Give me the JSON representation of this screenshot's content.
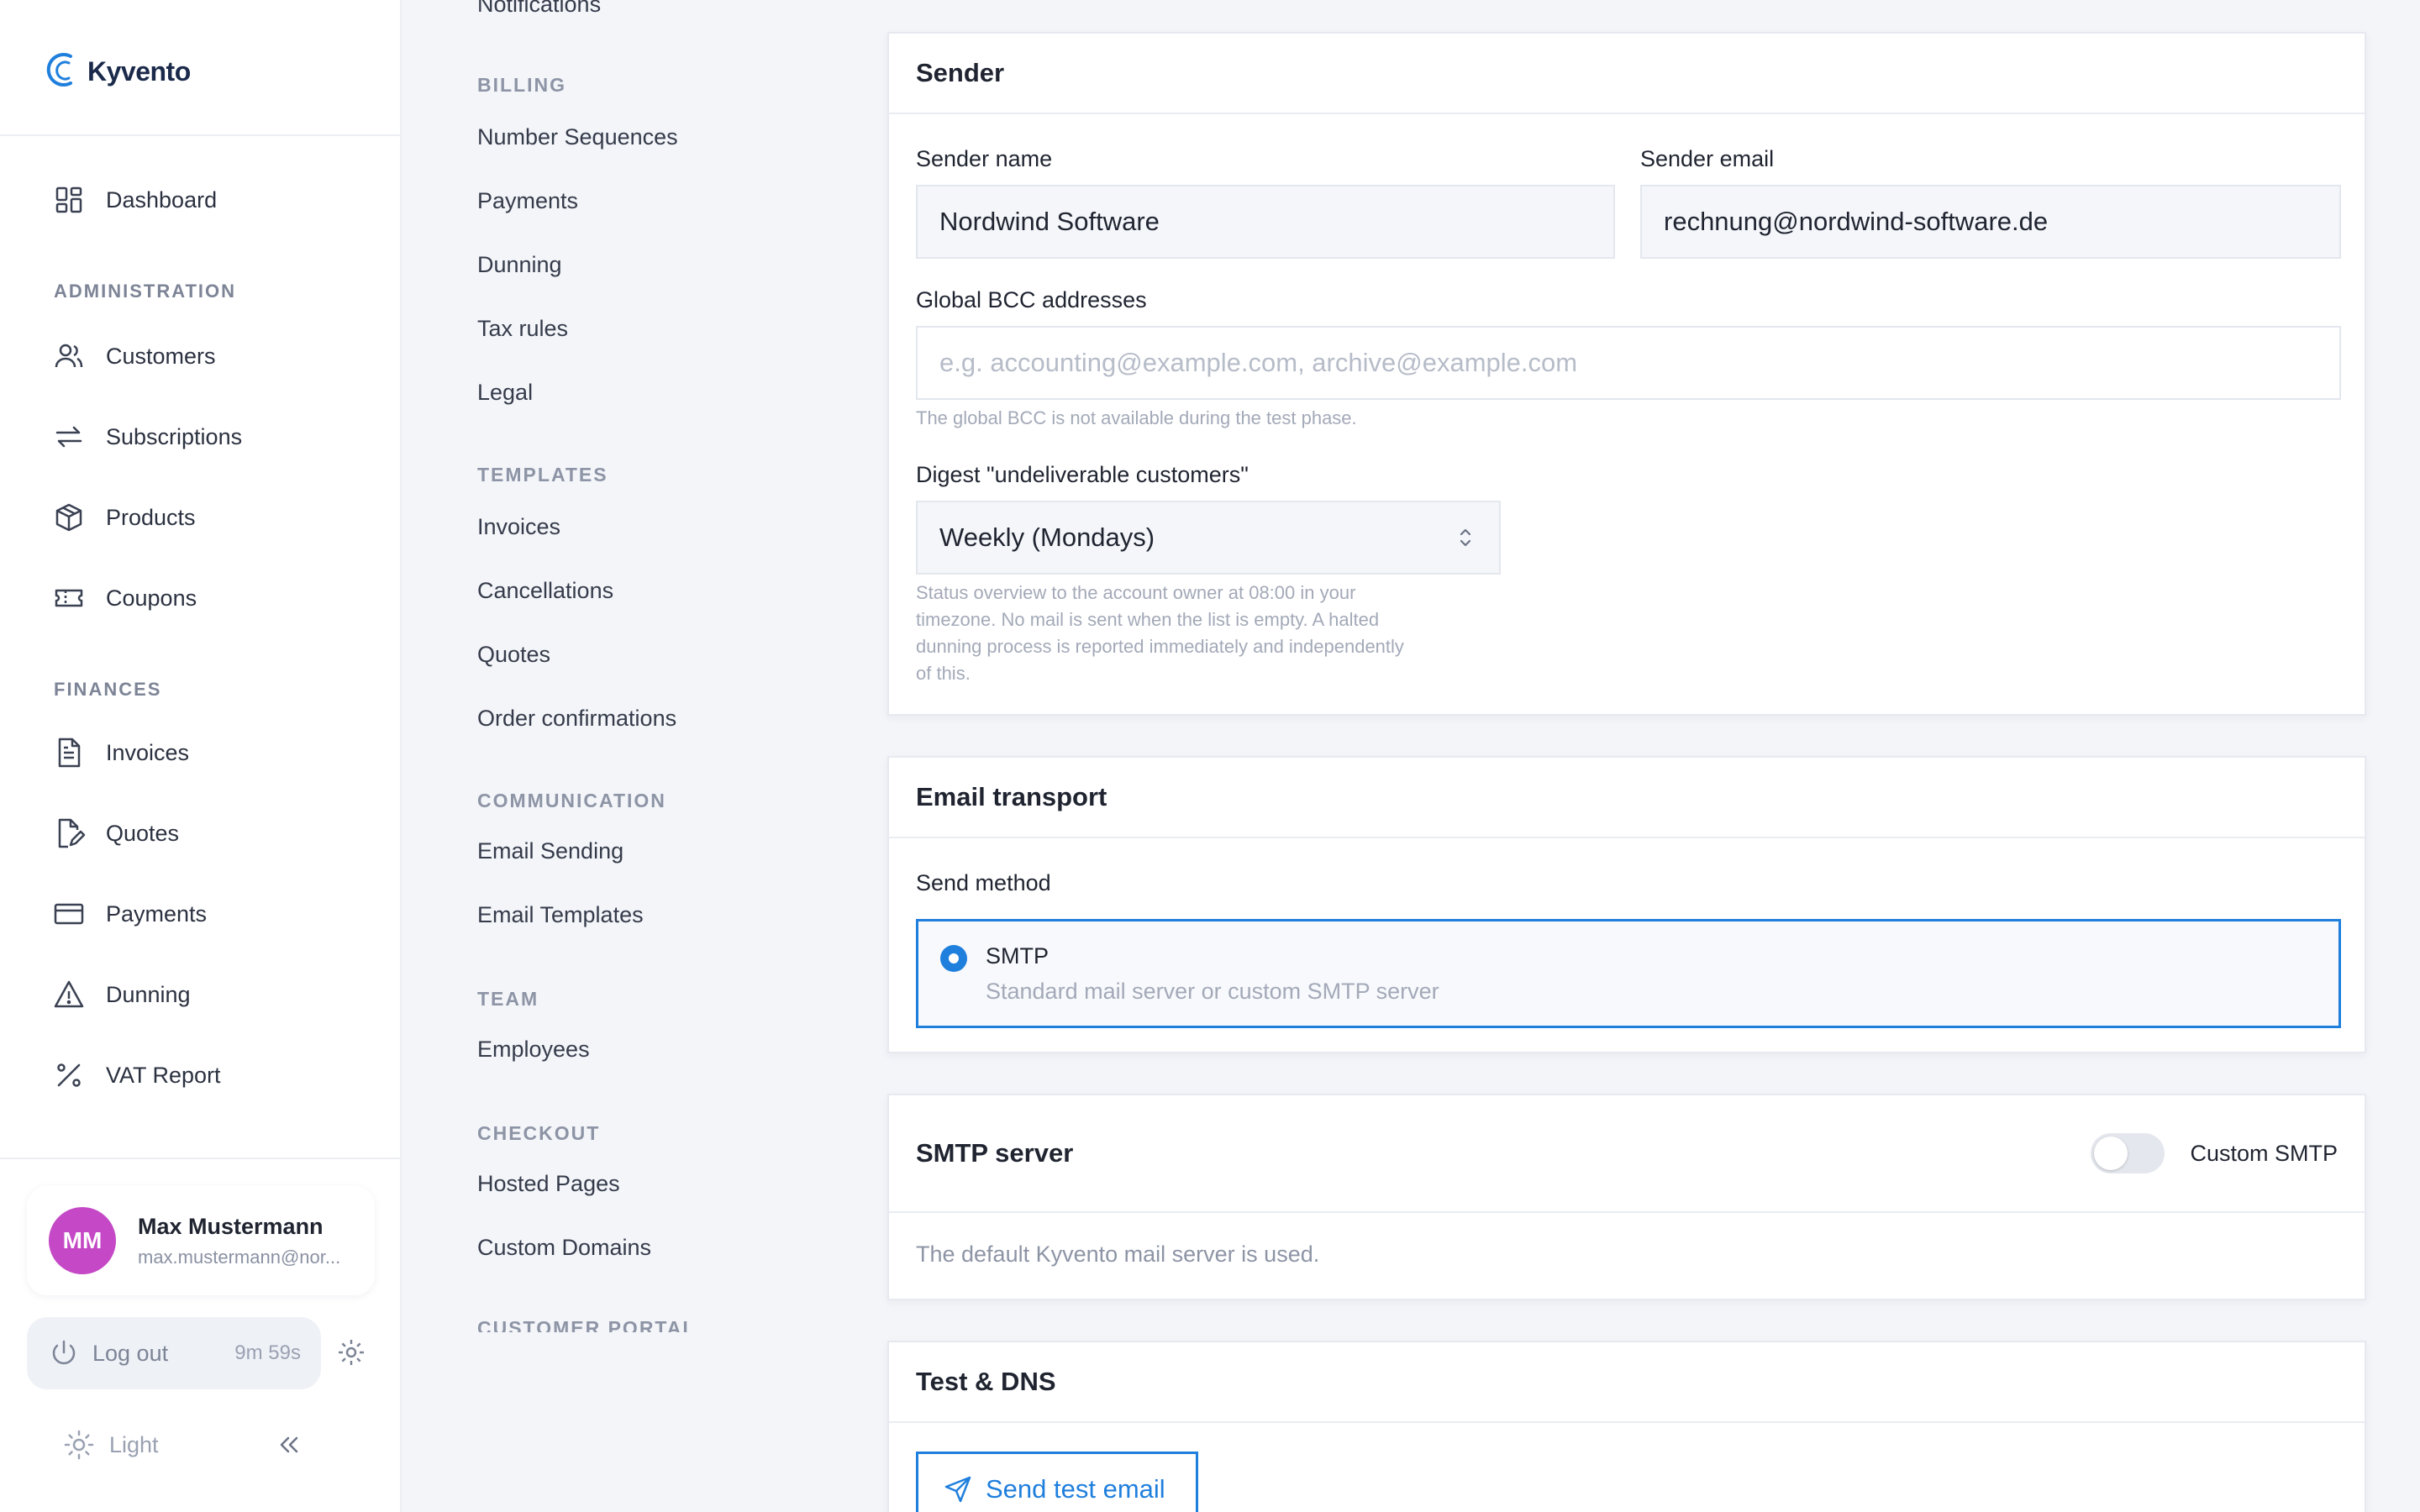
{
  "brand": {
    "name": "Kyvento"
  },
  "sidebar": {
    "dashboard": "Dashboard",
    "administration_heading": "ADMINISTRATION",
    "customers": "Customers",
    "subscriptions": "Subscriptions",
    "products": "Products",
    "coupons": "Coupons",
    "finances_heading": "FINANCES",
    "invoices": "Invoices",
    "quotes": "Quotes",
    "payments": "Payments",
    "dunning": "Dunning",
    "vat_report": "VAT Report"
  },
  "user": {
    "initials": "MM",
    "name": "Max Mustermann",
    "email": "max.mustermann@nor...",
    "logout_label": "Log out",
    "session_timer": "9m 59s",
    "theme_label": "Light"
  },
  "settings_nav": {
    "notifications": "Notifications",
    "billing_heading": "BILLING",
    "number_sequences": "Number Sequences",
    "payments": "Payments",
    "dunning": "Dunning",
    "tax_rules": "Tax rules",
    "legal": "Legal",
    "templates_heading": "TEMPLATES",
    "invoices": "Invoices",
    "cancellations": "Cancellations",
    "quotes": "Quotes",
    "order_confirmations": "Order confirmations",
    "communication_heading": "COMMUNICATION",
    "email_sending": "Email Sending",
    "email_templates": "Email Templates",
    "team_heading": "TEAM",
    "employees": "Employees",
    "checkout_heading": "CHECKOUT",
    "hosted_pages": "Hosted Pages",
    "custom_domains": "Custom Domains",
    "customer_portal_heading": "CUSTOMER PORTAL"
  },
  "sender": {
    "title": "Sender",
    "name_label": "Sender name",
    "name_value": "Nordwind Software",
    "email_label": "Sender email",
    "email_value": "rechnung@nordwind-software.de",
    "bcc_label": "Global BCC addresses",
    "bcc_placeholder": "e.g. accounting@example.com, archive@example.com",
    "bcc_help": "The global BCC is not available during the test phase.",
    "digest_label": "Digest \"undeliverable customers\"",
    "digest_value": "Weekly (Mondays)",
    "digest_help_1": "Status overview to the account owner at 08:00 in your",
    "digest_help_2": "timezone. No mail is sent when the list is empty. A halted",
    "digest_help_3": "dunning process is reported immediately and independently",
    "digest_help_4": "of this."
  },
  "transport": {
    "title": "Email transport",
    "method_label": "Send method",
    "option_title": "SMTP",
    "option_desc": "Standard mail server or custom SMTP server"
  },
  "smtp": {
    "title": "SMTP server",
    "toggle_label": "Custom SMTP",
    "info": "The default Kyvento mail server is used."
  },
  "test": {
    "title": "Test & DNS",
    "send_button": "Send test email"
  },
  "colors": {
    "accent": "#1f7fdd",
    "avatar": "#c549c6"
  }
}
